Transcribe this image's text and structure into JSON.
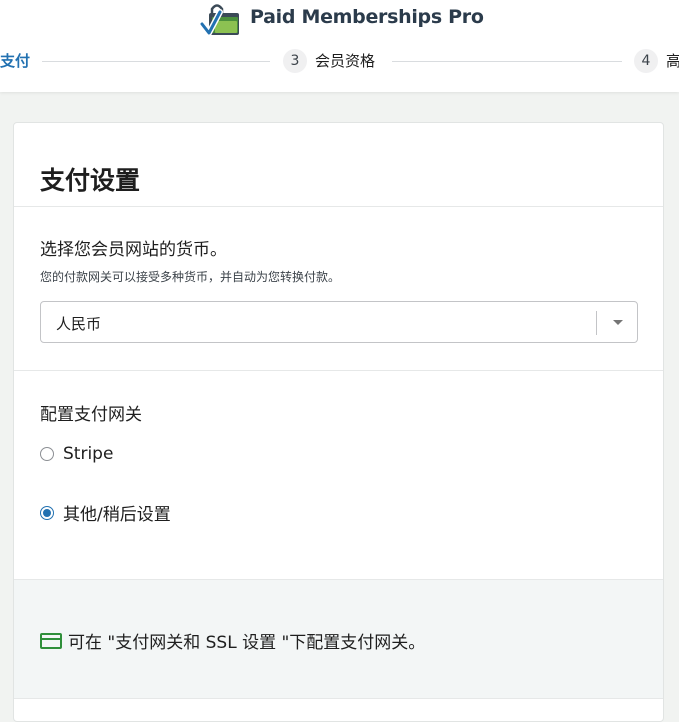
{
  "brand": {
    "name": "Paid Memberships Pro"
  },
  "steps": [
    {
      "number": "",
      "label": "支付",
      "state": "active"
    },
    {
      "number": "3",
      "label": "会员资格",
      "state": "upcoming"
    },
    {
      "number": "4",
      "label": "高",
      "state": "upcoming"
    }
  ],
  "card": {
    "title": "支付设置"
  },
  "currency": {
    "heading": "选择您会员网站的货币。",
    "help": "您的付款网关可以接受多种货币，并自动为您转换付款。",
    "selected": "人民币"
  },
  "gateway": {
    "heading": "配置支付网关",
    "options": [
      {
        "label": "Stripe",
        "checked": false
      },
      {
        "label": "其他/稍后设置",
        "checked": true
      }
    ]
  },
  "note": {
    "text": "可在 \"支付网关和 SSL 设置 \"下配置支付网关。"
  },
  "colors": {
    "accent": "#2271b1",
    "brand_green": "#2f8f3a",
    "text": "#1e1e1e"
  }
}
